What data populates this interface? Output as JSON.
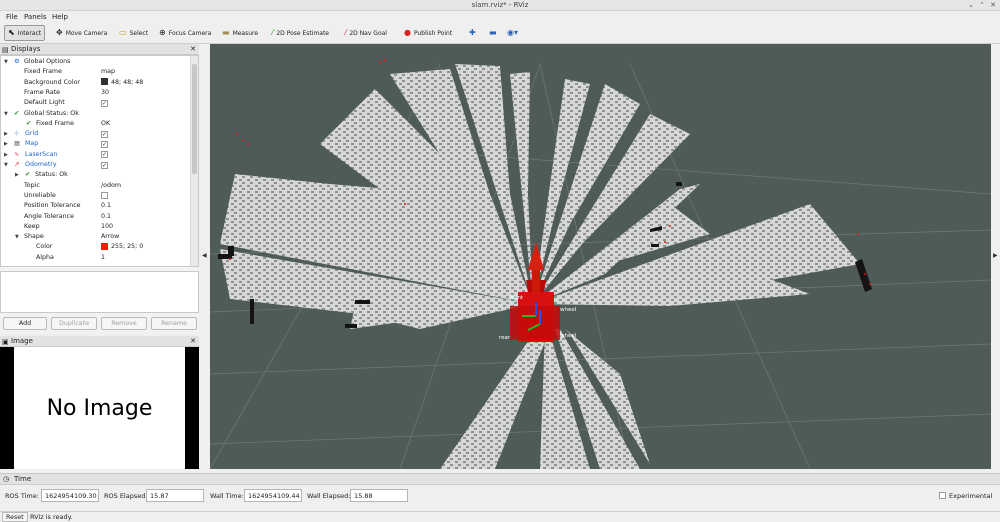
{
  "window": {
    "title": "slam.rviz* - RViz"
  },
  "menu": [
    "File",
    "Panels",
    "Help"
  ],
  "toolbar": [
    {
      "label": "Interact",
      "icon": "cursor-icon"
    },
    {
      "label": "Move Camera",
      "icon": "move-icon"
    },
    {
      "label": "Select",
      "icon": "select-icon"
    },
    {
      "label": "Focus Camera",
      "icon": "focus-icon"
    },
    {
      "label": "Measure",
      "icon": "ruler-icon"
    },
    {
      "label": "2D Pose Estimate",
      "icon": "green-arrow-icon"
    },
    {
      "label": "2D Nav Goal",
      "icon": "pink-arrow-icon"
    },
    {
      "label": "Publish Point",
      "icon": "pin-icon"
    }
  ],
  "displays": {
    "title": "Displays",
    "rows": {
      "global_options": "Global Options",
      "fixed_frame": {
        "label": "Fixed Frame",
        "value": "map"
      },
      "background_color": {
        "label": "Background Color",
        "value": "48; 48; 48",
        "color": "#303030"
      },
      "frame_rate": {
        "label": "Frame Rate",
        "value": "30"
      },
      "default_light": {
        "label": "Default Light"
      },
      "global_status": "Global Status: Ok",
      "global_fixed_frame": {
        "label": "Fixed Frame",
        "value": "OK"
      },
      "grid": "Grid",
      "map": "Map",
      "laserscan": "LaserScan",
      "odometry": "Odometry",
      "status_ok": "Status: Ok",
      "topic": {
        "label": "Topic",
        "value": "/odom"
      },
      "unreliable": {
        "label": "Unreliable"
      },
      "position_tolerance": {
        "label": "Position Tolerance",
        "value": "0.1"
      },
      "angle_tolerance": {
        "label": "Angle Tolerance",
        "value": "0.1"
      },
      "keep": {
        "label": "Keep",
        "value": "100"
      },
      "shape": {
        "label": "Shape",
        "value": "Arrow"
      },
      "color": {
        "label": "Color",
        "value": "255; 25; 0",
        "color": "#ff1900"
      },
      "alpha": {
        "label": "Alpha",
        "value": "1"
      }
    },
    "buttons": {
      "add": "Add",
      "duplicate": "Duplicate",
      "remove": "Remove",
      "rename": "Rename"
    }
  },
  "image_panel": {
    "title": "Image",
    "placeholder": "No Image"
  },
  "viewport": {
    "background": "#4f5b59",
    "labels": {
      "left_wheel": "wheel",
      "right_wheel": "wheel",
      "rear": "rear",
      "front": "front"
    }
  },
  "time": {
    "title": "Time",
    "ros_time_label": "ROS Time:",
    "ros_time": "1624954109.30",
    "ros_elapsed_label": "ROS Elapsed:",
    "ros_elapsed": "15.87",
    "wall_time_label": "Wall Time:",
    "wall_time": "1624954109.44",
    "wall_elapsed_label": "Wall Elapsed:",
    "wall_elapsed": "15.88",
    "experimental": "Experimental"
  },
  "status": {
    "reset": "Reset",
    "message": "RViz is ready."
  }
}
